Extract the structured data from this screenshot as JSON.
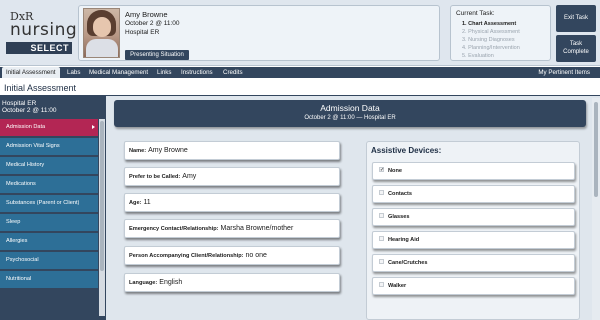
{
  "logo": {
    "line1": "DxR",
    "line2": "nursing",
    "line3": "SELECT"
  },
  "patient": {
    "name": "Amy Browne",
    "date": "October 2 @ 11:00",
    "location": "Hospital ER",
    "presenting_button": "Presenting Situation"
  },
  "task": {
    "title": "Current Task:",
    "items": [
      "1. Chart Assessment",
      "2. Physical Assessment",
      "3. Nursing Diagnoses",
      "4. Planning/Intervention",
      "5. Evaluation"
    ]
  },
  "buttons": {
    "exit": "Exit Task",
    "complete_line1": "Task",
    "complete_line2": "Complete"
  },
  "nav": {
    "tabs": [
      "Initial Assessment",
      "Labs",
      "Medical Management",
      "Links",
      "Instructions",
      "Credits"
    ],
    "right": "My Pertinent Items"
  },
  "page_title": "Initial Assessment",
  "sidebar": {
    "header_line1": "Hospital ER",
    "header_line2": "October 2 @ 11:00",
    "items": [
      "Admission Data",
      "Admission Vital Signs",
      "Medical History",
      "Medications",
      "Substances (Parent or Client)",
      "Sleep",
      "Allergies",
      "Psychosocial",
      "Nutritional"
    ]
  },
  "admission": {
    "title": "Admission Data",
    "subtitle": "October 2 @ 11:00 — Hospital ER"
  },
  "fields": [
    {
      "label": "Name:",
      "value": "Amy Browne"
    },
    {
      "label": "Prefer to be Called:",
      "value": "Amy"
    },
    {
      "label": "Age:",
      "value": "11"
    },
    {
      "label": "Emergency Contact/Relationship:",
      "value": "Marsha Browne/mother"
    },
    {
      "label": "Person Accompanying Client/Relationship:",
      "value": "no one"
    },
    {
      "label": "Language:",
      "value": "English"
    }
  ],
  "devices": {
    "title": "Assistive Devices:",
    "items": [
      "None",
      "Contacts",
      "Glasses",
      "Hearing Aid",
      "Cane/Crutches",
      "Walker"
    ],
    "checked": "None"
  }
}
